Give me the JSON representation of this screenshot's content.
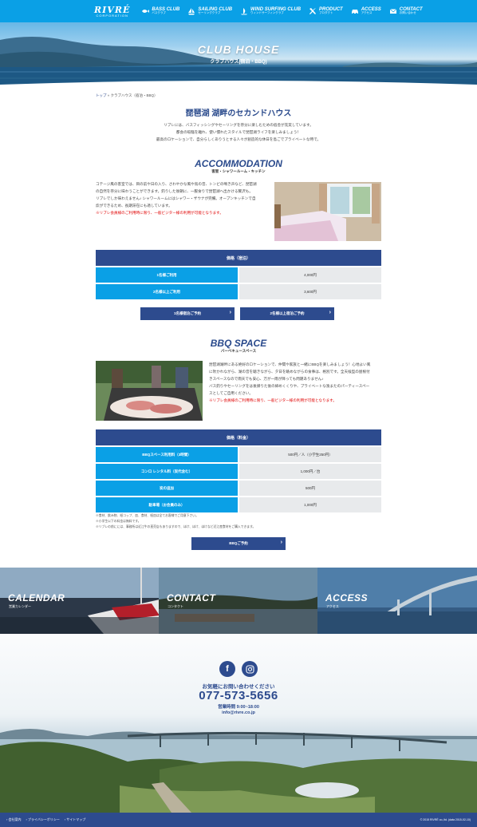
{
  "colors": {
    "header": "#0aa0e6",
    "navy": "#2d4b8e",
    "table_key": "#0aa0e6",
    "table_val": "#e8eaec",
    "red": "#e00000"
  },
  "header": {
    "logo_main": "RIVRÉ",
    "logo_sub": "CORPORATION",
    "nav": [
      {
        "label": "BASS CLUB",
        "sub": "バスクラブ",
        "icon": "fish-icon"
      },
      {
        "label": "SAILING CLUB",
        "sub": "セーリングクラブ",
        "icon": "sailboat-icon"
      },
      {
        "label": "WIND SURFING CLUB",
        "sub": "ウィンドサーフィンクラブ",
        "icon": "windsurf-icon"
      },
      {
        "label": "PRODUCT",
        "sub": "プロダクト",
        "icon": "tools-icon"
      },
      {
        "label": "ACCESS",
        "sub": "アクセス",
        "icon": "car-icon"
      },
      {
        "label": "CONTACT",
        "sub": "お問い合わせ",
        "icon": "mail-icon"
      }
    ]
  },
  "hero": {
    "title": "CLUB HOUSE",
    "subtitle": "クラブハウス(宿泊・BBQ)"
  },
  "breadcrumb": {
    "home": "トップ",
    "sep": "»",
    "current": "クラブハウス（宿泊・BBQ）"
  },
  "intro": {
    "heading": "琵琶湖 湖畔のセカンドハウス",
    "lines": [
      "リブレには、バスフィッシングやセーリングを存分に楽しむための宿舎が充実しています。",
      "都会の喧騒を離れ、使い慣れたスタイルで琵琶湖ライフを楽しみましょう！",
      "最高のロケーションで、自分らしくありうとする人々が創造的な休日を島ごでプライベートな時で。"
    ]
  },
  "accommodation": {
    "title": "ACCOMMODATION",
    "subtitle": "客室・シャワールーム・キッチン",
    "lines": [
      "コテージ風の客室では、目の前や日の入り、さわやかな風や鳥の音、トンビの鳴き声など、琵琶湖",
      "の自然を存分に味わうことができます。釣りした後朝に、一服食りで琵琶湖へ出かける贅沢も。",
      "リブレでしか味わえません♪ シャワールームにはシャワー・ザウナが完備。オープンキッチンで自",
      "炊ができるため、長期滞在にも適しています。"
    ],
    "note": "※リブレ会員様のご利用時に限り、一般ビジター様の利用が可能となります。",
    "price_table": {
      "header": "価格（宿泊）",
      "rows": [
        {
          "k": "1名様ご利用",
          "v": "4,000円"
        },
        {
          "k": "2名様以上ご利用",
          "v": "3,600円"
        }
      ]
    },
    "buttons": [
      "1名様宿泊ご予約",
      "2名様以上宿泊ご予約"
    ]
  },
  "bbq": {
    "title": "BBQ SPACE",
    "subtitle": "バーベキュースペース",
    "lines": [
      "琵琶湖湖畔にある絶好のロケーションで、仲間や家族と一緒にBBQを楽しみましょう！心地よい風",
      "に吹かれながら、湖の音を聴きながら、夕日を眺めながらの食事は、格別です。全天候型の屋根付",
      "きスペースなので雨天でも安心、万が一雨が降っても問題ありません♪",
      "バス釣りやセーリングをは後帰りた後の締めくくりや、プライベートな漁またのパーティースペー",
      "スとしてご自用ください。"
    ],
    "note": "※リブレ会員様のご利用時に限り、一般ビジター様の利用が可能となります。",
    "price_table": {
      "header": "価格（料金）",
      "rows": [
        {
          "k": "BBQスペース利用料（3時間）",
          "v": "500円／人（小学生250円）"
        },
        {
          "k": "コンロ レンタル料（炭代含む）",
          "v": "1,000円／台"
        },
        {
          "k": "炭の追加",
          "v": "500円"
        },
        {
          "k": "駐車場（お会員のみ）",
          "v": "1,000円"
        }
      ]
    },
    "notes": [
      "※食材、飲み物、紙コップ、皿、食材、紙皿は全てお客様でご用意下さい。",
      "※小学生以下の料金は無料です。",
      "※リブレの前にには、事務所は近江牛の直売店もありますので、ほけ、ほけ、ほけなど近江産食材をご購入できます。"
    ],
    "button": "BBQご予約"
  },
  "panels": [
    {
      "title": "CALENDAR",
      "sub": "営業カレンダー"
    },
    {
      "title": "CONTACT",
      "sub": "コンタクト"
    },
    {
      "title": "ACCESS",
      "sub": "アクセス"
    }
  ],
  "contact": {
    "facebook": "f",
    "cta": "お気軽にお問い合わせください",
    "tel": "077-573-5656",
    "hours": "営業時間 9:00~18:00",
    "email": "info@rivre.co.jp"
  },
  "footer": {
    "links": [
      "会社案内",
      "プライバシーポリシー",
      "サイトマップ"
    ],
    "copyright": "© 2015 RIVRÉ co.,ltd. (data 2015-02-10)"
  }
}
